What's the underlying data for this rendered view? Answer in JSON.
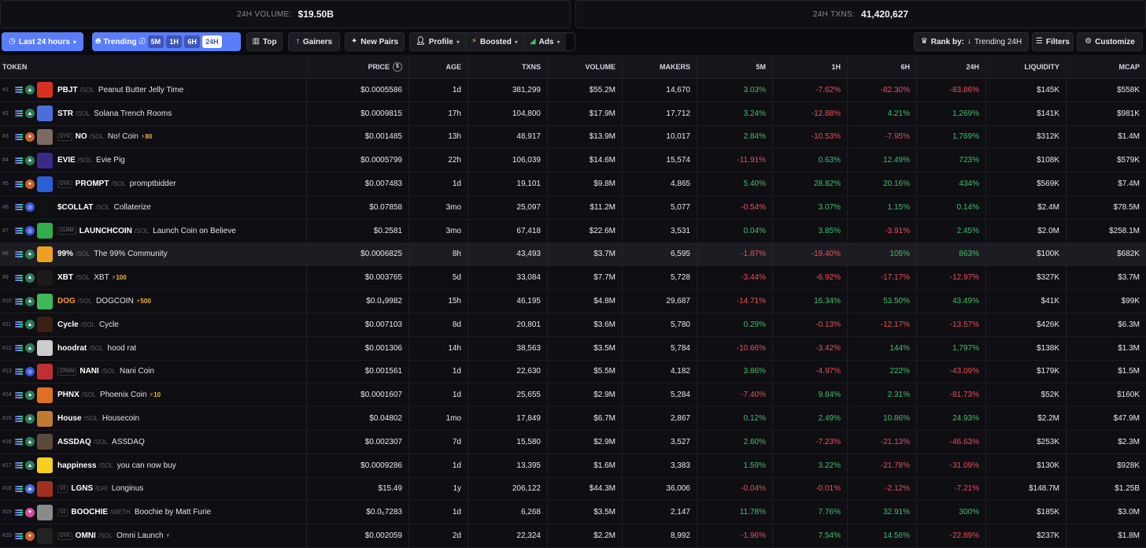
{
  "stats": {
    "volume_label": "24H VOLUME:",
    "volume_value": "$19.50B",
    "txns_label": "24H TXNS:",
    "txns_value": "41,420,627"
  },
  "toolbar": {
    "time_range": "Last 24 hours",
    "trending_label": "Trending",
    "timeframes": [
      "5M",
      "1H",
      "6H",
      "24H"
    ],
    "active_timeframe": "24H",
    "top_label": "Top",
    "gainers_label": "Gainers",
    "new_pairs_label": "New Pairs",
    "profile_label": "Profile",
    "boosted_label": "Boosted",
    "ads_label": "Ads",
    "rank_by_label": "Rank by:",
    "rank_by_value": "Trending 24H",
    "filters_label": "Filters",
    "customize_label": "Customize"
  },
  "table": {
    "headers": {
      "token": "TOKEN",
      "price": "PRICE",
      "age": "AGE",
      "txns": "TXNS",
      "volume": "VOLUME",
      "makers": "MAKERS",
      "m5": "5M",
      "h1": "1H",
      "h6": "6H",
      "h24": "24H",
      "liquidity": "LIQUIDITY",
      "mcap": "MCAP"
    },
    "rows": [
      {
        "rank": "#1",
        "tag": "",
        "symbol": "PBJT",
        "quote": "SOL",
        "name": "Peanut Butter Jelly Time",
        "boost": "",
        "price": "$0.0005586",
        "age": "1d",
        "txns": "381,299",
        "volume": "$55.2M",
        "makers": "14,670",
        "m5": "3.03%",
        "h1": "-7.62%",
        "h6": "-82.30%",
        "h24": "-83.86%",
        "liquidity": "$145K",
        "mcap": "$558K",
        "logo_color": "#d8311f",
        "dex": "pump"
      },
      {
        "rank": "#2",
        "tag": "",
        "symbol": "STR",
        "quote": "SOL",
        "name": "Solana Trench Rooms",
        "boost": "",
        "price": "$0.0009815",
        "age": "17h",
        "txns": "104,800",
        "volume": "$17.9M",
        "makers": "17,712",
        "m5": "3.24%",
        "h1": "-12.88%",
        "h6": "4.21%",
        "h24": "1,269%",
        "liquidity": "$141K",
        "mcap": "$981K",
        "logo_color": "#4a6fd8",
        "dex": "pump"
      },
      {
        "rank": "#3",
        "tag": "DYN",
        "symbol": "NO",
        "quote": "SOL",
        "name": "No! Coin",
        "boost": "⚡80",
        "price": "$0.001485",
        "age": "13h",
        "txns": "48,917",
        "volume": "$13.9M",
        "makers": "10,017",
        "m5": "2.84%",
        "h1": "-10.53%",
        "h6": "-7.95%",
        "h24": "1,769%",
        "liquidity": "$312K",
        "mcap": "$1.4M",
        "logo_color": "#7a6a60",
        "dex": "meteora"
      },
      {
        "rank": "#4",
        "tag": "",
        "symbol": "EVIE",
        "quote": "SOL",
        "name": "Evie Pig",
        "boost": "",
        "price": "$0.0005799",
        "age": "22h",
        "txns": "106,039",
        "volume": "$14.6M",
        "makers": "15,574",
        "m5": "-11.91%",
        "h1": "0.63%",
        "h6": "12.49%",
        "h24": "723%",
        "liquidity": "$108K",
        "mcap": "$579K",
        "logo_color": "#3a2a8a",
        "dex": "pump"
      },
      {
        "rank": "#5",
        "tag": "DYN",
        "symbol": "PROMPT",
        "quote": "SOL",
        "name": "promptbidder",
        "boost": "",
        "price": "$0.007483",
        "age": "1d",
        "txns": "19,101",
        "volume": "$9.8M",
        "makers": "4,865",
        "m5": "5.40%",
        "h1": "28.82%",
        "h6": "20.16%",
        "h24": "434%",
        "liquidity": "$569K",
        "mcap": "$7.4M",
        "logo_color": "#2a5fd8",
        "dex": "meteora"
      },
      {
        "rank": "#6",
        "tag": "",
        "symbol": "$COLLAT",
        "quote": "SOL",
        "name": "Collaterize",
        "boost": "",
        "price": "$0.07858",
        "age": "3mo",
        "txns": "25,097",
        "volume": "$11.2M",
        "makers": "5,077",
        "m5": "-0.54%",
        "h1": "3.07%",
        "h6": "1.15%",
        "h24": "0.14%",
        "liquidity": "$2.4M",
        "mcap": "$78.5M",
        "logo_color": "#111111",
        "dex": "raydium"
      },
      {
        "rank": "#7",
        "tag": "CLMM",
        "symbol": "LAUNCHCOIN",
        "quote": "SOL",
        "name": "Launch Coin on Believe",
        "boost": "",
        "price": "$0.2581",
        "age": "3mo",
        "txns": "67,418",
        "volume": "$22.6M",
        "makers": "3,531",
        "m5": "0.04%",
        "h1": "3.85%",
        "h6": "-3.91%",
        "h24": "2.45%",
        "liquidity": "$2.0M",
        "mcap": "$258.1M",
        "logo_color": "#2fae4a",
        "dex": "raydium"
      },
      {
        "rank": "#8",
        "tag": "",
        "symbol": "99%",
        "quote": "SOL",
        "name": "The 99% Community",
        "boost": "",
        "price": "$0.0006825",
        "age": "8h",
        "txns": "43,493",
        "volume": "$3.7M",
        "makers": "6,595",
        "m5": "-1.87%",
        "h1": "-19.40%",
        "h6": "105%",
        "h24": "863%",
        "liquidity": "$100K",
        "mcap": "$682K",
        "logo_color": "#f0a020",
        "dex": "pump"
      },
      {
        "rank": "#9",
        "tag": "",
        "symbol": "XBT",
        "quote": "SOL",
        "name": "XBT",
        "boost": "⚡100",
        "price": "$0.003765",
        "age": "5d",
        "txns": "33,084",
        "volume": "$7.7M",
        "makers": "5,728",
        "m5": "-3.44%",
        "h1": "-6.92%",
        "h6": "-17.17%",
        "h24": "-12.97%",
        "liquidity": "$327K",
        "mcap": "$3.7M",
        "logo_color": "#1a1a1a",
        "dex": "pump"
      },
      {
        "rank": "#10",
        "tag": "",
        "symbol": "DOG",
        "quote": "SOL",
        "name": "DOGCOIN",
        "boost": "⚡500",
        "price": "$0.0₄9982",
        "age": "15h",
        "txns": "46,195",
        "volume": "$4.8M",
        "makers": "29,687",
        "m5": "-14.71%",
        "h1": "16.34%",
        "h6": "53.50%",
        "h24": "43.49%",
        "liquidity": "$41K",
        "mcap": "$99K",
        "logo_color": "#3fb85a",
        "dex": "pump"
      },
      {
        "rank": "#11",
        "tag": "",
        "symbol": "Cycle",
        "quote": "SOL",
        "name": "Cycle",
        "boost": "",
        "price": "$0.007103",
        "age": "8d",
        "txns": "20,801",
        "volume": "$3.6M",
        "makers": "5,780",
        "m5": "0.29%",
        "h1": "-0.13%",
        "h6": "-12.17%",
        "h24": "-13.57%",
        "liquidity": "$426K",
        "mcap": "$6.3M",
        "logo_color": "#3a2010",
        "dex": "pump"
      },
      {
        "rank": "#12",
        "tag": "",
        "symbol": "hoodrat",
        "quote": "SOL",
        "name": "hood rat",
        "boost": "",
        "price": "$0.001306",
        "age": "14h",
        "txns": "38,563",
        "volume": "$3.5M",
        "makers": "5,784",
        "m5": "-10.66%",
        "h1": "-3.42%",
        "h6": "144%",
        "h24": "1,797%",
        "liquidity": "$138K",
        "mcap": "$1.3M",
        "logo_color": "#cccccc",
        "dex": "pump"
      },
      {
        "rank": "#13",
        "tag": "CPMM",
        "symbol": "NANI",
        "quote": "SOL",
        "name": "Nani Coin",
        "boost": "",
        "price": "$0.001561",
        "age": "1d",
        "txns": "22,630",
        "volume": "$5.5M",
        "makers": "4,182",
        "m5": "3.86%",
        "h1": "-4.97%",
        "h6": "222%",
        "h24": "-43.09%",
        "liquidity": "$179K",
        "mcap": "$1.5M",
        "logo_color": "#c03030",
        "dex": "raydium"
      },
      {
        "rank": "#14",
        "tag": "",
        "symbol": "PHNX",
        "quote": "SOL",
        "name": "Phoenix Coin",
        "boost": "⚡10",
        "price": "$0.0001607",
        "age": "1d",
        "txns": "25,655",
        "volume": "$2.9M",
        "makers": "5,284",
        "m5": "-7.40%",
        "h1": "9.84%",
        "h6": "2.31%",
        "h24": "-81.73%",
        "liquidity": "$52K",
        "mcap": "$160K",
        "logo_color": "#e07020",
        "dex": "pump"
      },
      {
        "rank": "#15",
        "tag": "",
        "symbol": "House",
        "quote": "SOL",
        "name": "Housecoin",
        "boost": "",
        "price": "$0.04802",
        "age": "1mo",
        "txns": "17,849",
        "volume": "$6.7M",
        "makers": "2,867",
        "m5": "0.12%",
        "h1": "2.49%",
        "h6": "10.86%",
        "h24": "24.93%",
        "liquidity": "$2.2M",
        "mcap": "$47.9M",
        "logo_color": "#c07a30",
        "dex": "pump"
      },
      {
        "rank": "#16",
        "tag": "",
        "symbol": "ASSDAQ",
        "quote": "SOL",
        "name": "ASSDAQ",
        "boost": "",
        "price": "$0.002307",
        "age": "7d",
        "txns": "15,580",
        "volume": "$2.9M",
        "makers": "3,527",
        "m5": "2.60%",
        "h1": "-7.23%",
        "h6": "-21.13%",
        "h24": "-46.63%",
        "liquidity": "$253K",
        "mcap": "$2.3M",
        "logo_color": "#5a4a3a",
        "dex": "pump"
      },
      {
        "rank": "#17",
        "tag": "",
        "symbol": "happiness",
        "quote": "SOL",
        "name": "you can now buy",
        "boost": "",
        "price": "$0.0009286",
        "age": "1d",
        "txns": "13,395",
        "volume": "$1.6M",
        "makers": "3,383",
        "m5": "1.59%",
        "h1": "3.22%",
        "h6": "-21.78%",
        "h24": "-31.09%",
        "liquidity": "$130K",
        "mcap": "$928K",
        "logo_color": "#f5d020",
        "dex": "pump"
      },
      {
        "rank": "#18",
        "tag": "V2",
        "symbol": "LGNS",
        "quote": "DAI",
        "name": "Longinus",
        "boost": "",
        "price": "$15.49",
        "age": "1y",
        "txns": "206,122",
        "volume": "$44.3M",
        "makers": "36,006",
        "m5": "-0.04%",
        "h1": "-0.01%",
        "h6": "-2.12%",
        "h24": "-7.21%",
        "liquidity": "$148.7M",
        "mcap": "$1.25B",
        "logo_color": "#a03020",
        "dex": "quickswap"
      },
      {
        "rank": "#19",
        "tag": "V2",
        "symbol": "BOOCHIE",
        "quote": "WETH",
        "name": "Boochie by Matt Furie",
        "boost": "",
        "price": "$0.0₆7283",
        "age": "1d",
        "txns": "6,268",
        "volume": "$3.5M",
        "makers": "2,147",
        "m5": "11.78%",
        "h1": "7.76%",
        "h6": "32.91%",
        "h24": "300%",
        "liquidity": "$185K",
        "mcap": "$3.0M",
        "logo_color": "#8a8a8a",
        "dex": "uniswap"
      },
      {
        "rank": "#20",
        "tag": "DYN",
        "symbol": "OMNI",
        "quote": "SOL",
        "name": "Omni Launch",
        "boost": "⚡",
        "price": "$0.002059",
        "age": "2d",
        "txns": "22,324",
        "volume": "$2.2M",
        "makers": "8,992",
        "m5": "-1.96%",
        "h1": "7.54%",
        "h6": "14.56%",
        "h24": "-22.89%",
        "liquidity": "$237K",
        "mcap": "$1.8M",
        "logo_color": "#222222",
        "dex": "meteora"
      }
    ]
  },
  "colors": {
    "accent": "#5a7dfa",
    "positive": "#41c06a",
    "negative": "#ee4f5a",
    "boost": "#f5b52b"
  }
}
